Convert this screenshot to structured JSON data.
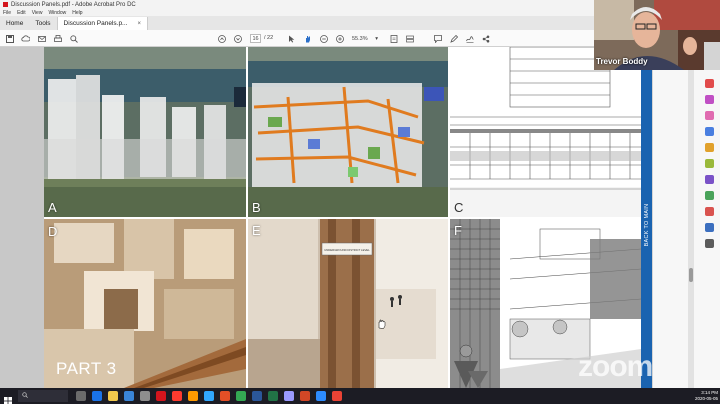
{
  "window": {
    "title": "Discussion Panels.pdf - Adobe Acrobat Pro DC",
    "menu": [
      "File",
      "Edit",
      "View",
      "Window",
      "Help"
    ]
  },
  "tabs": [
    {
      "label": "Home"
    },
    {
      "label": "Tools"
    },
    {
      "label": "Discussion Panels.p...",
      "close": "×"
    }
  ],
  "toolbar": {
    "page_current": "16",
    "page_total": "/ 22",
    "zoom": "55.3%",
    "zoom_caret": "▾"
  },
  "panels": {
    "a": "A",
    "b": "B",
    "c": "C",
    "d": "D",
    "e": "E",
    "f": "F"
  },
  "model_sign": "UNDERGROUND DISTRICT LEVEL",
  "part_label": "PART 3",
  "back_label": "BACK TO MAIN",
  "webcam": {
    "name": "Trevor Boddy"
  },
  "zoom_watermark": "zoom",
  "taskbar": {
    "search_placeholder": "",
    "time": "3:14 PM",
    "date": "2020-05-05"
  },
  "colors": {
    "acrobat_red": "#d4151d",
    "sidebar_blue": "#1a63b0",
    "taskbar": "#1c1c24"
  }
}
